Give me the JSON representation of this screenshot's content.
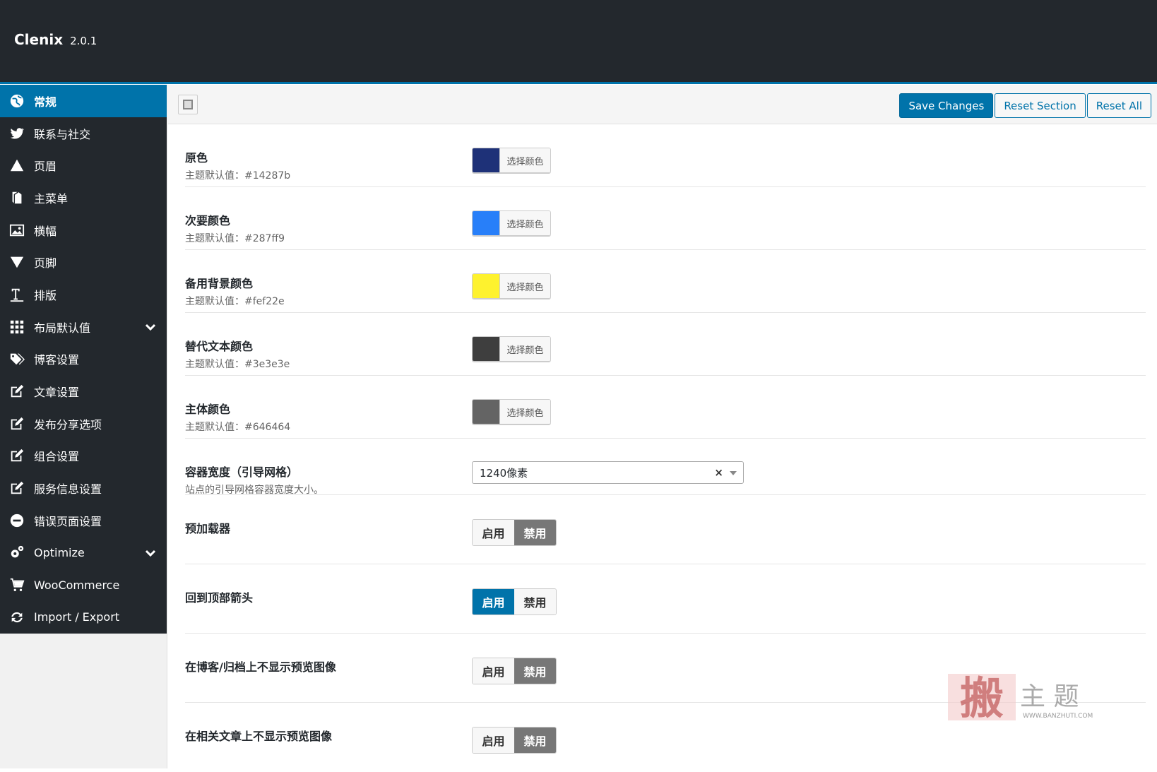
{
  "app": {
    "name": "Clenix",
    "version": "2.0.1"
  },
  "sidebar": {
    "items": [
      {
        "label": "常规",
        "icon": "globe-icon",
        "active": true
      },
      {
        "label": "联系与社交",
        "icon": "twitter-icon"
      },
      {
        "label": "页眉",
        "icon": "triangle-up-icon"
      },
      {
        "label": "主菜单",
        "icon": "book-icon"
      },
      {
        "label": "横幅",
        "icon": "image-icon"
      },
      {
        "label": "页脚",
        "icon": "triangle-down-icon"
      },
      {
        "label": "排版",
        "icon": "text-height-icon"
      },
      {
        "label": "布局默认值",
        "icon": "grid-icon",
        "expandable": true
      },
      {
        "label": "博客设置",
        "icon": "tags-icon"
      },
      {
        "label": "文章设置",
        "icon": "edit-icon"
      },
      {
        "label": "发布分享选项",
        "icon": "edit-icon"
      },
      {
        "label": "组合设置",
        "icon": "edit-icon"
      },
      {
        "label": "服务信息设置",
        "icon": "edit-icon"
      },
      {
        "label": "错误页面设置",
        "icon": "minus-circle-icon"
      },
      {
        "label": "Optimize",
        "icon": "cogs-icon",
        "expandable": true
      },
      {
        "label": "WooCommerce",
        "icon": "cart-icon"
      },
      {
        "label": "Import / Export",
        "icon": "refresh-icon"
      }
    ]
  },
  "toolbar": {
    "save": "Save Changes",
    "reset_section": "Reset Section",
    "reset_all": "Reset All"
  },
  "colors": {
    "pick_label": "选择颜色",
    "items": [
      {
        "title": "原色",
        "desc": "主题默认值：#14287b",
        "value": "#1e3178"
      },
      {
        "title": "次要颜色",
        "desc": "主题默认值：#287ff9",
        "value": "#287ff9"
      },
      {
        "title": "备用背景颜色",
        "desc": "主题默认值：#fef22e",
        "value": "#fef22e"
      },
      {
        "title": "替代文本颜色",
        "desc": "主题默认值：#3e3e3e",
        "value": "#3e3e3e"
      },
      {
        "title": "主体颜色",
        "desc": "主题默认值：#646464",
        "value": "#646464"
      }
    ]
  },
  "container": {
    "title": "容器宽度（引导网格）",
    "desc": "站点的引导网格容器宽度大小。",
    "value": "1240像素",
    "clear": "×"
  },
  "toggles": {
    "enable": "启用",
    "disable": "禁用",
    "items": [
      {
        "title": "预加载器",
        "state": "disabled"
      },
      {
        "title": "回到顶部箭头",
        "state": "enabled"
      },
      {
        "title": "在博客/归档上不显示预览图像",
        "state": "disabled"
      },
      {
        "title": "在相关文章上不显示预览图像",
        "state": "disabled"
      }
    ]
  },
  "watermark": {
    "char": "搬",
    "text": "主 题",
    "url": "WWW.BANZHUTI.COM"
  }
}
